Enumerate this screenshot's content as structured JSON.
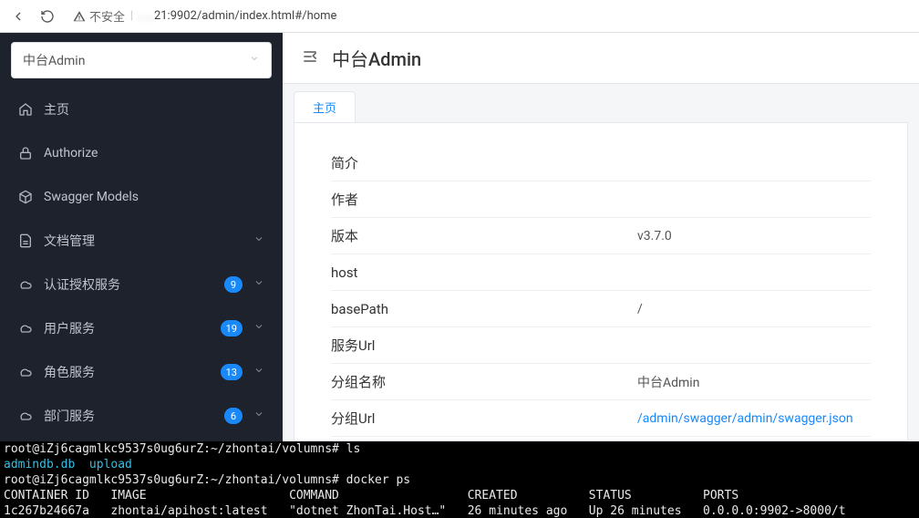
{
  "browser": {
    "insecure_label": "不安全",
    "url_masked": "  .   .   .",
    "url_visible": "21:9902/admin/index.html#/home"
  },
  "sidebar": {
    "site_name": "中台Admin",
    "items": [
      {
        "icon": "home-icon",
        "label": "主页",
        "badge": null,
        "expandable": false
      },
      {
        "icon": "lock-icon",
        "label": "Authorize",
        "badge": null,
        "expandable": false
      },
      {
        "icon": "cube-icon",
        "label": "Swagger Models",
        "badge": null,
        "expandable": false
      },
      {
        "icon": "doc-icon",
        "label": "文档管理",
        "badge": null,
        "expandable": true
      },
      {
        "icon": "cloud-icon",
        "label": "认证授权服务",
        "badge": "9",
        "expandable": true
      },
      {
        "icon": "cloud-icon",
        "label": "用户服务",
        "badge": "19",
        "expandable": true
      },
      {
        "icon": "cloud-icon",
        "label": "角色服务",
        "badge": "13",
        "expandable": true
      },
      {
        "icon": "cloud-icon",
        "label": "部门服务",
        "badge": "6",
        "expandable": true
      }
    ]
  },
  "main": {
    "app_title": "中台Admin",
    "tab_label": "主页",
    "rows": [
      {
        "label": "简介",
        "value": ""
      },
      {
        "label": "作者",
        "value": ""
      },
      {
        "label": "版本",
        "value": "v3.7.0"
      },
      {
        "label": "host",
        "value": ""
      },
      {
        "label": "basePath",
        "value": "/"
      },
      {
        "label": "服务Url",
        "value": ""
      },
      {
        "label": "分组名称",
        "value": "中台Admin"
      },
      {
        "label": "分组Url",
        "value": "/admin/swagger/admin/swagger.json",
        "is_link": true
      }
    ]
  },
  "terminal": {
    "line1_prompt": "root@iZj6cagmlkc9537s0ug6urZ:~/zhontai/volumns#",
    "line1_cmd": " ls",
    "line2": "admindb.db  upload",
    "line3_prompt": "root@iZj6cagmlkc9537s0ug6urZ:~/zhontai/volumns#",
    "line3_cmd": " docker ps",
    "header": "CONTAINER ID   IMAGE                    COMMAND                  CREATED          STATUS          PORTS",
    "row": "1c267b24667a   zhontai/apihost:latest   \"dotnet ZhonTai.Host…\"   26 minutes ago   Up 26 minutes   0.0.0.0:9902->8000/t"
  }
}
